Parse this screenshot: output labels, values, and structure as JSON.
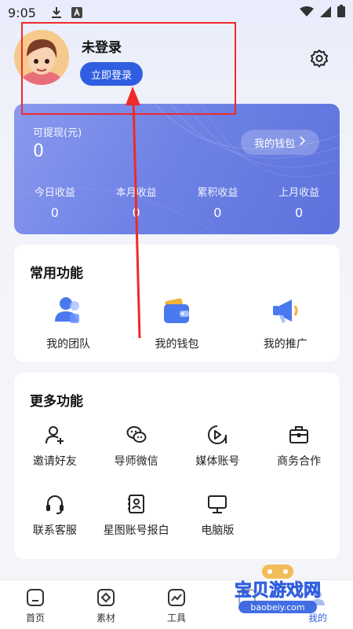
{
  "status_bar": {
    "time": "9:05"
  },
  "profile": {
    "username": "未登录",
    "login_button": "立即登录"
  },
  "wallet": {
    "withdrawable_label": "可提现(元)",
    "withdrawable_amount": "0",
    "my_wallet_button": "我的钱包",
    "stats": [
      {
        "label": "今日收益",
        "value": "0"
      },
      {
        "label": "本月收益",
        "value": "0"
      },
      {
        "label": "累积收益",
        "value": "0"
      },
      {
        "label": "上月收益",
        "value": "0"
      }
    ]
  },
  "common_functions": {
    "title": "常用功能",
    "items": [
      {
        "label": "我的团队",
        "icon": "team-icon"
      },
      {
        "label": "我的钱包",
        "icon": "wallet-icon"
      },
      {
        "label": "我的推广",
        "icon": "megaphone-icon"
      }
    ]
  },
  "more_functions": {
    "title": "更多功能",
    "items": [
      {
        "label": "邀请好友",
        "icon": "add-user-icon"
      },
      {
        "label": "导师微信",
        "icon": "wechat-icon"
      },
      {
        "label": "媒体账号",
        "icon": "media-play-icon"
      },
      {
        "label": "商务合作",
        "icon": "briefcase-icon"
      },
      {
        "label": "联系客服",
        "icon": "headset-icon"
      },
      {
        "label": "星图账号报白",
        "icon": "contact-card-icon"
      },
      {
        "label": "电脑版",
        "icon": "monitor-icon"
      }
    ]
  },
  "bottom_nav": {
    "items": [
      {
        "label": "首页",
        "icon": "home-icon"
      },
      {
        "label": "素材",
        "icon": "material-icon"
      },
      {
        "label": "工具",
        "icon": "chart-icon"
      },
      {
        "label": "",
        "icon": "tab-4-icon"
      },
      {
        "label": "我的",
        "icon": "profile-icon"
      }
    ],
    "active_index": 4
  },
  "watermark": {
    "name": "宝贝游戏网",
    "domain": "baobeiy.com"
  },
  "colors": {
    "accent": "#2f5ee0",
    "annotation": "#ee2a2a"
  }
}
